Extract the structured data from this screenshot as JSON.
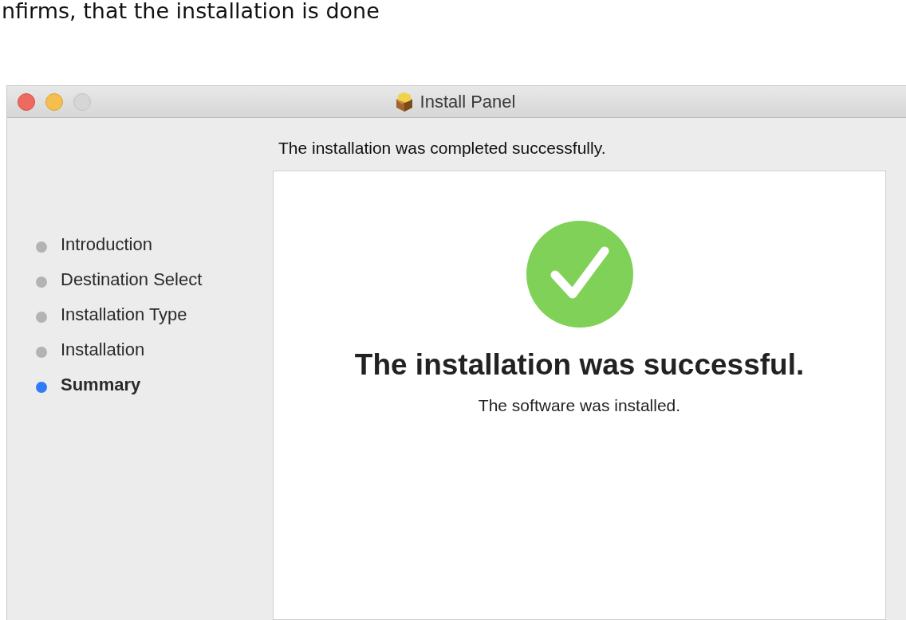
{
  "caption": "nfirms, that the installation is done",
  "window": {
    "title": "Install Panel"
  },
  "steps": [
    {
      "label": "Introduction",
      "selected": false
    },
    {
      "label": "Destination Select",
      "selected": false
    },
    {
      "label": "Installation Type",
      "selected": false
    },
    {
      "label": "Installation",
      "selected": false
    },
    {
      "label": "Summary",
      "selected": true
    }
  ],
  "header": "The installation was completed successfully.",
  "result": {
    "heading": "The installation was successful.",
    "message": "The software was installed."
  }
}
